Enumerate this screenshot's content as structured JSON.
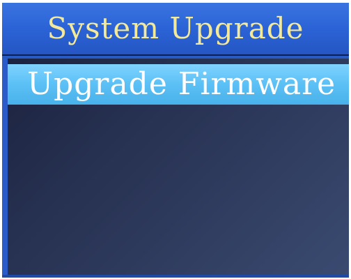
{
  "header": {
    "title": "System Upgrade"
  },
  "menu": {
    "items": [
      {
        "label": "Upgrade Firmware",
        "selected": true
      }
    ]
  },
  "colors": {
    "title_text": "#f3e99a",
    "title_bar": "#2b63d6",
    "selected_item": "#5bc0f5",
    "list_background": "#2a3556"
  }
}
